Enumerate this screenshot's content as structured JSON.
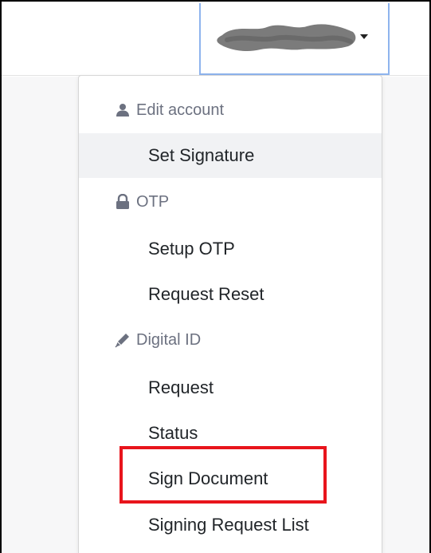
{
  "colors": {
    "accent_border": "#8eb4ee",
    "highlight": "#e8141c",
    "header_text": "#6c7180",
    "item_text": "#212529",
    "active_bg": "#f1f2f4"
  },
  "user_menu": {
    "toggle_icon": "chevron-down-icon"
  },
  "dropdown": {
    "sections": [
      {
        "header": "Edit account",
        "icon": "user-icon",
        "items": [
          {
            "label": "Set Signature",
            "active": true
          }
        ]
      },
      {
        "header": "OTP",
        "icon": "lock-icon",
        "items": [
          {
            "label": "Setup OTP"
          },
          {
            "label": "Request Reset"
          }
        ]
      },
      {
        "header": "Digital ID",
        "icon": "pen-icon",
        "items": [
          {
            "label": "Request"
          },
          {
            "label": "Status"
          },
          {
            "label": "Sign Document",
            "highlighted": true
          },
          {
            "label": "Signing Request List"
          }
        ]
      }
    ]
  }
}
